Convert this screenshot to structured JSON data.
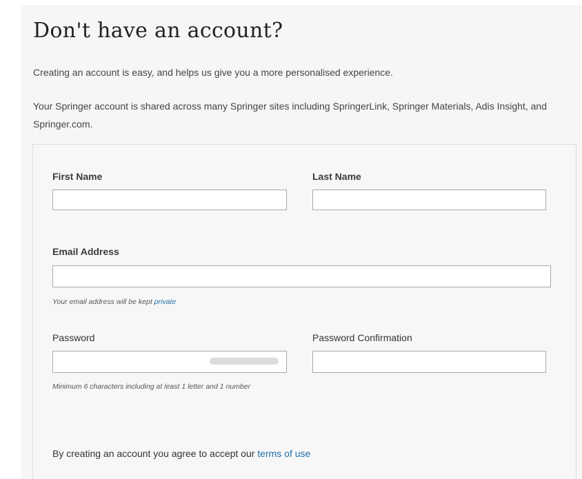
{
  "heading": "Don't have an account?",
  "intro_text": "Creating an account is easy, and helps us give you a more personalised experience.",
  "shared_text": "Your Springer account is shared across many Springer sites including SpringerLink, Springer Materials, Adis Insight, and Springer.com.",
  "form": {
    "first_name": {
      "label": "First Name",
      "value": ""
    },
    "last_name": {
      "label": "Last Name",
      "value": ""
    },
    "email": {
      "label": "Email Address",
      "value": "",
      "hint_text": "Your email address will be kept",
      "hint_link": "private"
    },
    "password": {
      "label": "Password",
      "value": "",
      "hint": "Minimum 6 characters including at least 1 letter and 1 number",
      "strength": 0
    },
    "password_confirmation": {
      "label": "Password Confirmation",
      "value": ""
    }
  },
  "terms": {
    "text": "By creating an account you agree to accept our",
    "link": "terms of use"
  },
  "colors": {
    "link": "#1f6fa8",
    "background": "#f6f6f6",
    "input_border": "#a9a9a9"
  }
}
